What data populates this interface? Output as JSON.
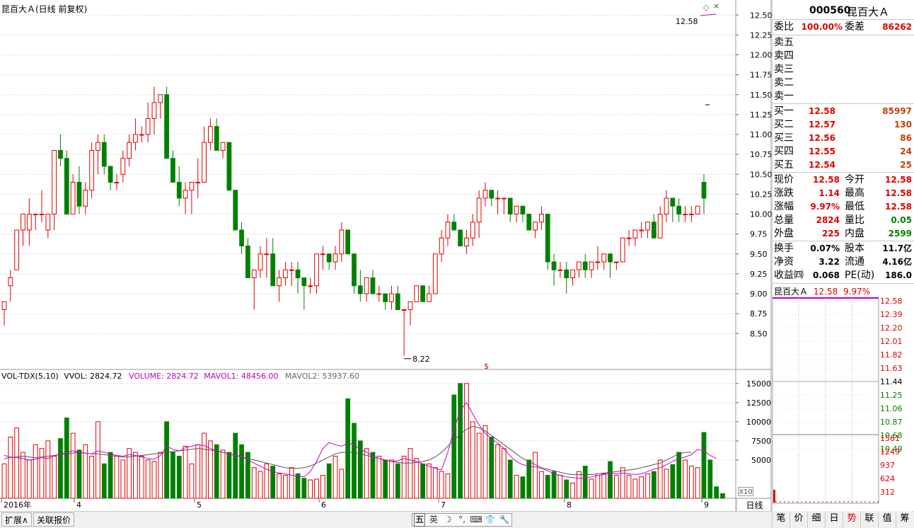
{
  "stock": {
    "title": "昆百大Ａ(日线 前复权)",
    "code": "000560",
    "name": "昆百大Ａ"
  },
  "price_axis": [
    "12.50",
    "12.25",
    "12.00",
    "11.75",
    "11.50",
    "11.25",
    "11.00",
    "10.75",
    "10.50",
    "10.25",
    "10.00",
    "9.75",
    "9.50",
    "9.25",
    "9.00",
    "8.75",
    "8.50"
  ],
  "annotations": {
    "high_label": "12.58",
    "low_label": "8.22",
    "s_marker": "$"
  },
  "volume": {
    "header_name": "VOL-TDX(5,10)",
    "header_vvol": "VVOL: 2824.72",
    "header_volume": "VOLUME: 2824.72",
    "header_mavol1": "MAVOL1: 48456.00",
    "header_mavol2": "MAVOL2: 53937.60",
    "axis": [
      "15000",
      "12500",
      "10000",
      "7500",
      "5000"
    ],
    "multiplier": "X10"
  },
  "x_axis": {
    "labels": [
      "2016年",
      "4",
      "5",
      "6",
      "7",
      "8",
      "9"
    ],
    "period_button": "日线"
  },
  "bottom_tabs": {
    "expand": "扩展∧",
    "related": "关联报价"
  },
  "ime": [
    "五",
    "英",
    "☽",
    "°,",
    "⌨",
    "👕",
    "🔧"
  ],
  "right_tabs": [
    "笔",
    "价",
    "细",
    "日",
    "势",
    "联",
    "值",
    "筹"
  ],
  "quote": {
    "weibi_label": "委比",
    "weibi_value": "100.00%",
    "weicha_label": "委差",
    "weicha_value": "86262",
    "sell": [
      {
        "label": "卖五"
      },
      {
        "label": "卖四"
      },
      {
        "label": "卖三"
      },
      {
        "label": "卖二"
      },
      {
        "label": "卖一"
      }
    ],
    "buy": [
      {
        "label": "买一",
        "price": "12.58",
        "vol": "85997"
      },
      {
        "label": "买二",
        "price": "12.57",
        "vol": "130"
      },
      {
        "label": "买三",
        "price": "12.56",
        "vol": "86"
      },
      {
        "label": "买四",
        "price": "12.55",
        "vol": "24"
      },
      {
        "label": "买五",
        "price": "12.54",
        "vol": "25"
      }
    ],
    "stats": [
      {
        "l1": "现价",
        "v1": "12.58",
        "c1": "red",
        "l2": "今开",
        "v2": "12.58",
        "c2": "red"
      },
      {
        "l1": "涨跌",
        "v1": "1.14",
        "c1": "red",
        "l2": "最高",
        "v2": "12.58",
        "c2": "red"
      },
      {
        "l1": "涨幅",
        "v1": "9.97%",
        "c1": "red",
        "l2": "最低",
        "v2": "12.58",
        "c2": "red"
      },
      {
        "l1": "总量",
        "v1": "2824",
        "c1": "red",
        "l2": "量比",
        "v2": "0.05",
        "c2": "green"
      },
      {
        "l1": "外盘",
        "v1": "225",
        "c1": "red",
        "l2": "内盘",
        "v2": "2599",
        "c2": "green"
      }
    ],
    "fund": [
      {
        "l1": "换手",
        "v1": "0.07%",
        "l2": "股本",
        "v2": "11.7亿"
      },
      {
        "l1": "净资",
        "v1": "3.22",
        "l2": "流通",
        "v2": "4.16亿"
      },
      {
        "l1": "收益㈣",
        "v1": "0.068",
        "l2": "PE(动)",
        "v2": "186.0"
      }
    ]
  },
  "mini": {
    "name": "昆百大Ａ",
    "price": "12.58",
    "pct": "9.97%",
    "price_axis": [
      "12.58",
      "12.39",
      "12.20",
      "12.01",
      "11.82",
      "11.63",
      "11.44",
      "11.25",
      "11.06",
      "10.87",
      "10.68",
      "10.49"
    ],
    "vol_axis": [
      "1561",
      "1249",
      "937",
      "624",
      "312"
    ]
  },
  "chart_data": {
    "type": "candlestick",
    "title": "昆百大Ａ(日线 前复权)",
    "ylim": [
      8.2,
      12.6
    ],
    "annotations": {
      "max": 12.58,
      "min": 8.22
    },
    "candles": [
      [
        8.8,
        8.9,
        8.6,
        8.9
      ],
      [
        9.1,
        9.3,
        8.9,
        9.2
      ],
      [
        9.3,
        9.8,
        9.3,
        9.8
      ],
      [
        9.8,
        10.0,
        9.6,
        10.0
      ],
      [
        9.8,
        10.2,
        9.6,
        10.0
      ],
      [
        10.0,
        10.0,
        9.8,
        10.0
      ],
      [
        10.0,
        10.3,
        9.9,
        10.0
      ],
      [
        9.8,
        10.0,
        9.7,
        10.0
      ],
      [
        10.0,
        10.8,
        9.8,
        10.8
      ],
      [
        10.8,
        11.0,
        10.6,
        10.7
      ],
      [
        10.7,
        10.8,
        10.0,
        10.0
      ],
      [
        10.0,
        10.5,
        10.0,
        10.4
      ],
      [
        10.4,
        10.6,
        10.0,
        10.1
      ],
      [
        10.1,
        10.4,
        10.0,
        10.3
      ],
      [
        10.3,
        10.9,
        10.2,
        10.8
      ],
      [
        10.8,
        11.0,
        10.5,
        10.9
      ],
      [
        10.9,
        11.0,
        10.5,
        10.6
      ],
      [
        10.6,
        10.6,
        10.3,
        10.4
      ],
      [
        10.4,
        10.5,
        10.3,
        10.4
      ],
      [
        10.5,
        10.8,
        10.4,
        10.7
      ],
      [
        10.7,
        11.0,
        10.6,
        10.9
      ],
      [
        10.9,
        11.2,
        10.8,
        11.0
      ],
      [
        11.0,
        11.1,
        10.9,
        11.0
      ],
      [
        11.0,
        11.4,
        10.9,
        11.2
      ],
      [
        11.2,
        11.6,
        11.0,
        11.4
      ],
      [
        11.4,
        11.5,
        11.2,
        11.5
      ],
      [
        11.5,
        11.6,
        10.7,
        10.7
      ],
      [
        10.7,
        10.8,
        10.4,
        10.4
      ],
      [
        10.4,
        10.6,
        10.1,
        10.2
      ],
      [
        10.2,
        10.4,
        10.0,
        10.3
      ],
      [
        10.3,
        10.4,
        10.0,
        10.4
      ],
      [
        10.4,
        10.7,
        10.2,
        10.4
      ],
      [
        10.4,
        11.1,
        10.4,
        10.9
      ],
      [
        10.9,
        11.2,
        10.8,
        11.1
      ],
      [
        11.1,
        11.2,
        10.8,
        10.8
      ],
      [
        10.8,
        10.9,
        10.7,
        10.9
      ],
      [
        10.9,
        10.9,
        10.3,
        10.3
      ],
      [
        10.3,
        10.3,
        9.8,
        9.8
      ],
      [
        9.8,
        9.9,
        9.5,
        9.6
      ],
      [
        9.6,
        9.7,
        9.2,
        9.2
      ],
      [
        9.2,
        9.2,
        8.8,
        9.3
      ],
      [
        9.3,
        9.6,
        9.2,
        9.5
      ],
      [
        9.5,
        9.7,
        9.2,
        9.5
      ],
      [
        9.5,
        9.7,
        9.1,
        9.1
      ],
      [
        9.1,
        9.3,
        8.9,
        9.2
      ],
      [
        9.2,
        9.4,
        9.1,
        9.3
      ],
      [
        9.3,
        9.4,
        9.1,
        9.3
      ],
      [
        9.3,
        9.4,
        9.0,
        9.2
      ],
      [
        9.2,
        9.2,
        8.8,
        9.1
      ],
      [
        9.1,
        9.2,
        9.0,
        9.1
      ],
      [
        9.1,
        9.5,
        9.0,
        9.5
      ],
      [
        9.5,
        9.6,
        9.3,
        9.5
      ],
      [
        9.5,
        9.5,
        9.3,
        9.4
      ],
      [
        9.4,
        9.6,
        9.3,
        9.5
      ],
      [
        9.5,
        9.9,
        9.4,
        9.8
      ],
      [
        9.8,
        9.8,
        9.5,
        9.5
      ],
      [
        9.5,
        9.5,
        9.0,
        9.1
      ],
      [
        9.1,
        9.3,
        8.9,
        9.0
      ],
      [
        9.0,
        9.2,
        8.9,
        9.2
      ],
      [
        9.2,
        9.3,
        9.0,
        9.0
      ],
      [
        9.0,
        9.1,
        8.9,
        9.0
      ],
      [
        9.0,
        9.0,
        8.8,
        8.9
      ],
      [
        8.9,
        9.1,
        8.8,
        9.0
      ],
      [
        9.0,
        9.1,
        8.8,
        8.8
      ],
      [
        8.8,
        8.8,
        8.22,
        8.8
      ],
      [
        8.8,
        8.9,
        8.6,
        8.9
      ],
      [
        8.9,
        9.1,
        8.9,
        9.1
      ],
      [
        9.1,
        9.1,
        8.9,
        8.9
      ],
      [
        8.9,
        9.1,
        8.9,
        9.0
      ],
      [
        9.0,
        9.5,
        9.0,
        9.5
      ],
      [
        9.5,
        9.8,
        9.4,
        9.7
      ],
      [
        9.7,
        10.0,
        9.6,
        9.9
      ],
      [
        9.9,
        10.0,
        9.8,
        9.8
      ],
      [
        9.8,
        9.8,
        9.6,
        9.6
      ],
      [
        9.6,
        9.8,
        9.5,
        9.7
      ],
      [
        9.7,
        10.0,
        9.6,
        9.9
      ],
      [
        9.9,
        10.3,
        9.7,
        10.2
      ],
      [
        10.2,
        10.4,
        10.1,
        10.3
      ],
      [
        10.3,
        10.3,
        10.1,
        10.2
      ],
      [
        10.2,
        10.3,
        10.0,
        10.2
      ],
      [
        10.2,
        10.2,
        10.0,
        10.2
      ],
      [
        10.2,
        10.2,
        9.9,
        10.0
      ],
      [
        10.0,
        10.1,
        9.9,
        10.1
      ],
      [
        10.1,
        10.1,
        9.9,
        10.0
      ],
      [
        10.0,
        10.0,
        9.8,
        9.8
      ],
      [
        9.8,
        9.9,
        9.7,
        9.9
      ],
      [
        9.9,
        10.1,
        9.8,
        10.0
      ],
      [
        10.0,
        10.0,
        9.3,
        9.4
      ],
      [
        9.4,
        9.5,
        9.1,
        9.3
      ],
      [
        9.3,
        9.4,
        9.2,
        9.3
      ],
      [
        9.3,
        9.4,
        9.0,
        9.2
      ],
      [
        9.2,
        9.3,
        9.1,
        9.3
      ],
      [
        9.3,
        9.4,
        9.2,
        9.4
      ],
      [
        9.4,
        9.5,
        9.2,
        9.3
      ],
      [
        9.3,
        9.4,
        9.2,
        9.4
      ],
      [
        9.4,
        9.6,
        9.3,
        9.4
      ],
      [
        9.4,
        9.5,
        9.3,
        9.5
      ],
      [
        9.5,
        9.5,
        9.2,
        9.4
      ],
      [
        9.4,
        9.4,
        9.3,
        9.4
      ],
      [
        9.4,
        9.7,
        9.4,
        9.7
      ],
      [
        9.7,
        9.8,
        9.6,
        9.7
      ],
      [
        9.7,
        9.8,
        9.6,
        9.8
      ],
      [
        9.8,
        9.9,
        9.7,
        9.8
      ],
      [
        9.8,
        9.9,
        9.7,
        9.9
      ],
      [
        9.9,
        10.0,
        9.7,
        9.7
      ],
      [
        9.7,
        10.1,
        9.7,
        10.0
      ],
      [
        10.0,
        10.3,
        9.9,
        10.2
      ],
      [
        10.2,
        10.2,
        9.9,
        10.1
      ],
      [
        10.1,
        10.2,
        9.9,
        10.0
      ],
      [
        10.0,
        10.1,
        9.9,
        10.0
      ],
      [
        10.0,
        10.1,
        9.9,
        10.0
      ],
      [
        10.0,
        10.1,
        10.0,
        10.1
      ],
      [
        10.4,
        10.5,
        10.0,
        10.2
      ]
    ],
    "volume": [
      4500,
      8000,
      9200,
      6000,
      5000,
      7000,
      6500,
      7500,
      5500,
      7800,
      10500,
      8500,
      6300,
      7000,
      5500,
      10000,
      4500,
      6000,
      5500,
      5000,
      6500,
      6000,
      5500,
      5000,
      4800,
      6000,
      10000,
      6000,
      5500,
      6800,
      4500,
      7000,
      8500,
      7500,
      7000,
      6300,
      6000,
      8500,
      7000,
      6000,
      4000,
      3500,
      4500,
      4200,
      3200,
      3000,
      4000,
      3200,
      2600,
      2400,
      2500,
      3000,
      4500,
      5500,
      3800,
      13000,
      9800,
      7500,
      6500,
      6000,
      5500,
      5000,
      5000,
      4500,
      5500,
      6500,
      5200,
      4500,
      4500,
      4000,
      3500,
      3200,
      13500,
      15000,
      15000,
      10000,
      8500,
      9500,
      8000,
      7000,
      6500,
      5000,
      3000,
      2800,
      5000,
      6000,
      3500,
      3000,
      3500,
      3000,
      2400,
      2000,
      3500,
      4200,
      2500,
      3000,
      3200,
      4800,
      3000,
      4000,
      3000,
      2500,
      2800,
      3200,
      3500,
      5000,
      3800,
      4400,
      6000,
      5000,
      4200,
      4000,
      8600,
      5000,
      1500,
      600
    ],
    "mavol1": [
      5600,
      5400,
      5300,
      5200,
      5000,
      5100,
      5300,
      5200,
      5600,
      5800,
      6000,
      6200,
      6000,
      5900,
      5800,
      6200,
      6000,
      5800,
      5600,
      5500,
      5700,
      5600,
      5400,
      5200,
      5100,
      5600,
      6800,
      6400,
      6200,
      6600,
      6800,
      7000,
      6900,
      6500,
      6200,
      6000,
      5800,
      5600,
      5500,
      5000,
      4600,
      4200,
      3800,
      3500,
      3300,
      3200,
      3000,
      2900,
      2800,
      3500,
      4800,
      6500,
      7300,
      7000,
      6800,
      7200,
      7000,
      6400,
      6000,
      5500,
      5200,
      5000,
      4800,
      4900,
      5200,
      5000,
      4800,
      4500,
      4200,
      3900,
      3700,
      6000,
      9000,
      11500,
      12500,
      11000,
      9600,
      8500,
      7800,
      7200,
      6500,
      5500,
      4800,
      4400,
      4200,
      4100,
      3900,
      3600,
      3200,
      3000,
      2800,
      2700,
      2600,
      2600,
      2800,
      3000,
      3100,
      3300,
      3200,
      3300,
      3200,
      3100,
      3200,
      3500,
      3800,
      4000,
      4400,
      4800,
      5200,
      5400,
      5700,
      6400,
      6200,
      5600,
      5200
    ],
    "mavol2": [
      5200,
      5300,
      5400,
      5500,
      5400,
      5300,
      5400,
      5500,
      5600,
      5700,
      5800,
      5900,
      6000,
      5900,
      5800,
      5800,
      5700,
      5600,
      5500,
      5400,
      5400,
      5500,
      5600,
      5700,
      5800,
      5900,
      6000,
      6100,
      6200,
      6300,
      6400,
      6500,
      6400,
      6300,
      6200,
      6000,
      5800,
      5600,
      5400,
      5200,
      5000,
      4800,
      4600,
      4400,
      4200,
      4000,
      3900,
      3900,
      4000,
      4200,
      4600,
      5000,
      5400,
      5800,
      6000,
      6000,
      6000,
      5800,
      5600,
      5400,
      5200,
      5000,
      4800,
      4700,
      4600,
      4600,
      4700,
      4800,
      5000,
      5400,
      6000,
      6800,
      7600,
      8400,
      9000,
      9400,
      9200,
      8800,
      8200,
      7600,
      7000,
      6400,
      5800,
      5200,
      4800,
      4400,
      4000,
      3800,
      3600,
      3400,
      3200,
      3100,
      3100,
      3100,
      3100,
      3200,
      3300,
      3400,
      3500,
      3600,
      3700,
      3800,
      4000,
      4200,
      4400,
      4600,
      5000,
      5400,
      5800,
      6000,
      6000
    ]
  }
}
